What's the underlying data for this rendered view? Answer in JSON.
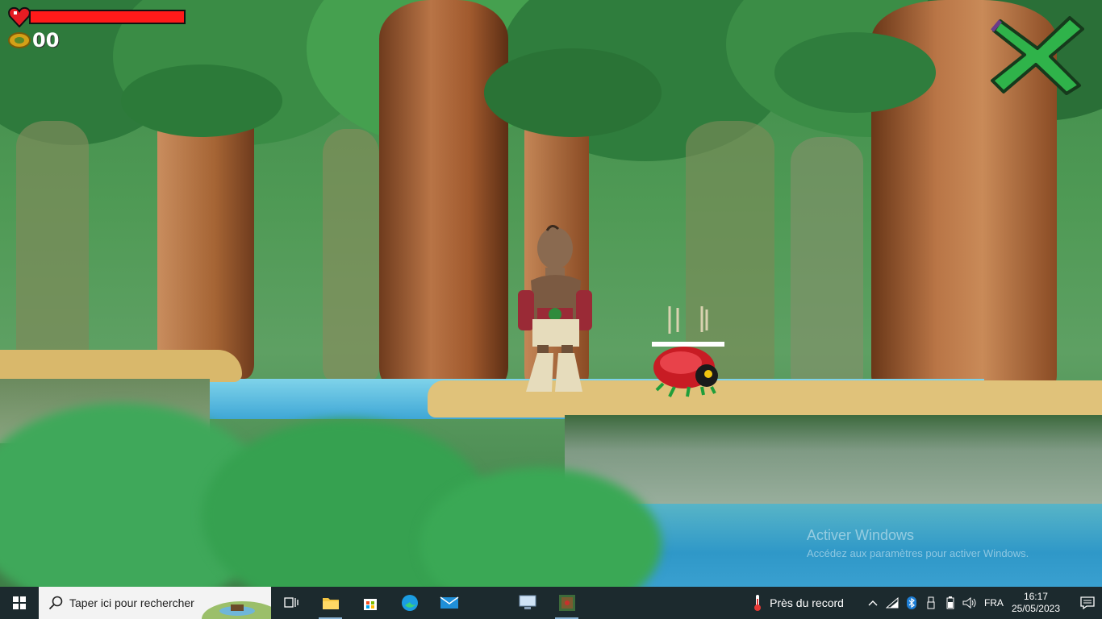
{
  "hud": {
    "health_fraction": 1.0,
    "coin_count": "00"
  },
  "watermark": {
    "title": "Activer Windows",
    "subtitle": "Accédez aux paramètres pour activer Windows."
  },
  "taskbar": {
    "search_placeholder": "Taper ici pour rechercher",
    "apps": [
      "task-view-icon",
      "file-explorer-icon",
      "microsoft-store-icon",
      "edge-icon",
      "mail-icon",
      "network-pc-icon",
      "game-app-icon"
    ],
    "weather_text": "Près du record",
    "language": "FRA",
    "time": "16:17",
    "date": "25/05/2023"
  },
  "colors": {
    "health": "#ff1a1a",
    "close_x": "#2fb34a",
    "taskbar": "#1c2a2e"
  }
}
